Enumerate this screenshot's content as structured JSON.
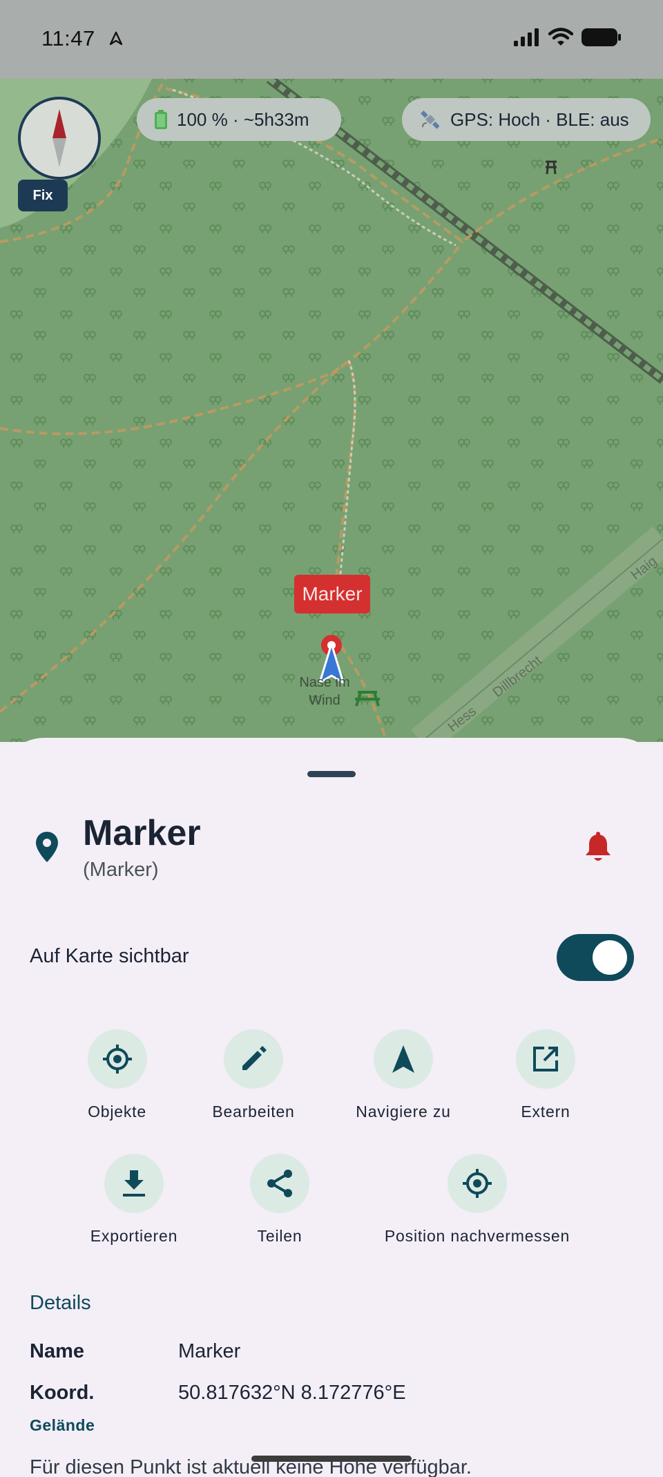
{
  "status_bar": {
    "time": "11:47"
  },
  "map": {
    "battery_text": "100 % · ~5h33m",
    "gps_text": "GPS: Hoch · BLE: aus",
    "fix_label": "Fix",
    "marker_label": "Marker",
    "place_name": "Nase im Wind",
    "colors": {
      "background": "#77a172",
      "marker_red": "#d3302f"
    }
  },
  "sheet": {
    "title": "Marker",
    "subtitle": "(Marker)",
    "visible_label": "Auf Karte sichtbar",
    "visible_on": true,
    "actions": [
      {
        "label": "Objekte",
        "icon": "crosshair-icon"
      },
      {
        "label": "Bearbeiten",
        "icon": "pencil-icon"
      },
      {
        "label": "Navigiere zu",
        "icon": "navigation-arrow-icon"
      },
      {
        "label": "Extern",
        "icon": "open-external-icon"
      },
      {
        "label": "Exportieren",
        "icon": "download-icon"
      },
      {
        "label": "Teilen",
        "icon": "share-icon"
      },
      {
        "label": "Position nachvermessen",
        "icon": "remeasure-position-icon"
      }
    ],
    "details": {
      "header": "Details",
      "name_key": "Name",
      "name_value": "Marker",
      "coord_key": "Koord.",
      "coord_value": "50.817632°N 8.172776°E",
      "terrain_label": "Gelände",
      "terrain_text": "Für diesen Punkt ist aktuell keine Höhe verfügbar."
    },
    "colors": {
      "accent": "#0e4a5a",
      "bell": "#c62828"
    }
  }
}
